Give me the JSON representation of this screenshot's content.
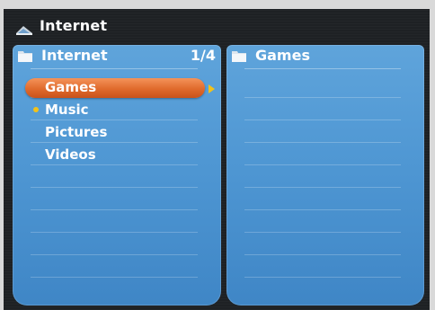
{
  "window": {
    "title": "Internet",
    "icon": "network-icon"
  },
  "left_pane": {
    "title": "Internet",
    "count": "1/4",
    "icon": "folder-icon",
    "items": [
      {
        "label": "Games",
        "selected": true
      },
      {
        "label": "Music",
        "selected": false
      },
      {
        "label": "Pictures",
        "selected": false
      },
      {
        "label": "Videos",
        "selected": false
      }
    ]
  },
  "right_pane": {
    "title": "Games",
    "icon": "folder-icon",
    "items": []
  },
  "colors": {
    "pane": "#4f97d3",
    "selection": "#e06a2c",
    "indicator": "#f2c21a",
    "background": "#1e2124"
  }
}
